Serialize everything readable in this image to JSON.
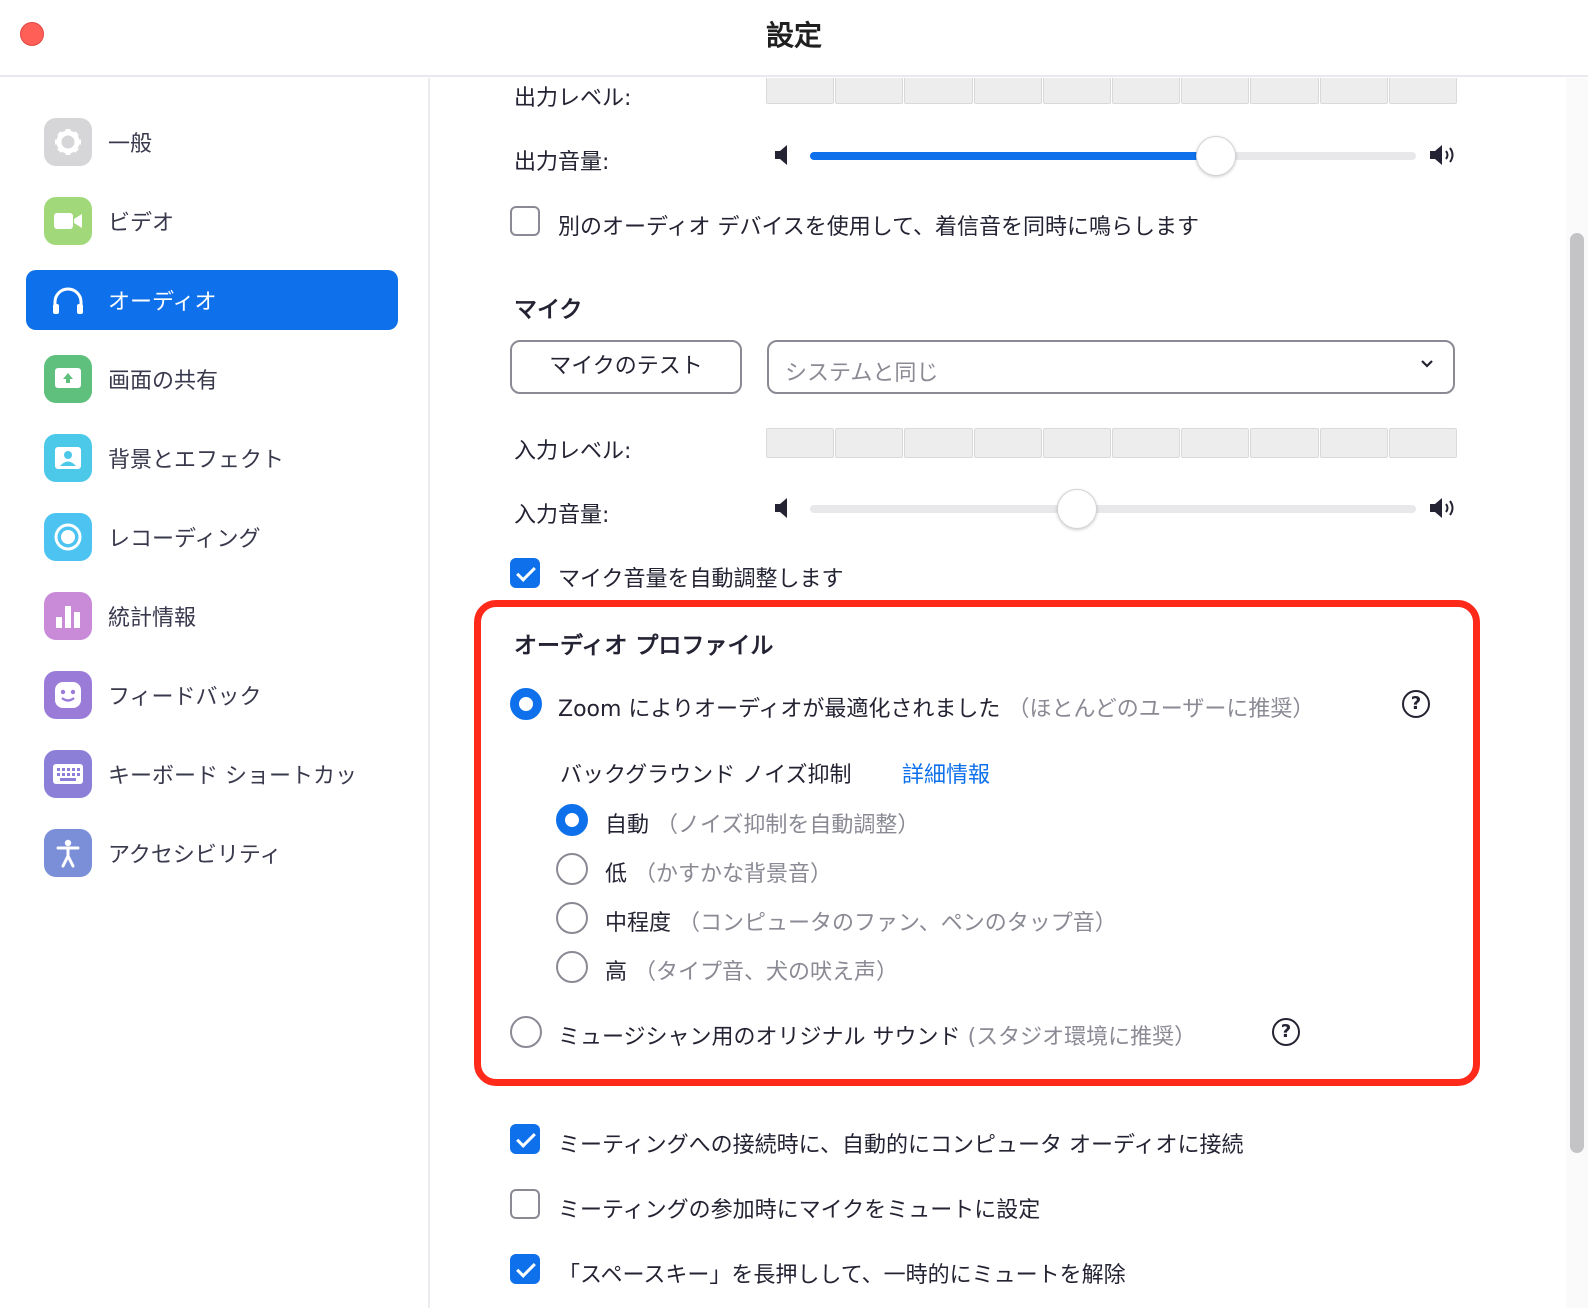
{
  "window": {
    "title": "設定"
  },
  "sidebar": {
    "items": [
      {
        "label": "一般",
        "icon": "gear-icon",
        "color": "#d6d6d8",
        "active": false
      },
      {
        "label": "ビデオ",
        "icon": "video-camera-icon",
        "color": "#a1d87a",
        "active": false
      },
      {
        "label": "オーディオ",
        "icon": "headphones-icon",
        "color": "#0e71eb",
        "active": true
      },
      {
        "label": "画面の共有",
        "icon": "share-screen-icon",
        "color": "#5fbf7d",
        "active": false
      },
      {
        "label": "背景とエフェクト",
        "icon": "background-person-icon",
        "color": "#4cc9e8",
        "active": false
      },
      {
        "label": "レコーディング",
        "icon": "record-icon",
        "color": "#4cc3f0",
        "active": false
      },
      {
        "label": "統計情報",
        "icon": "bar-chart-icon",
        "color": "#c98bd8",
        "active": false
      },
      {
        "label": "フィードバック",
        "icon": "smile-icon",
        "color": "#9b7bd8",
        "active": false
      },
      {
        "label": "キーボード ショートカッ",
        "icon": "keyboard-icon",
        "color": "#8b7fd8",
        "active": false
      },
      {
        "label": "アクセシビリティ",
        "icon": "accessibility-icon",
        "color": "#7b8fd8",
        "active": false
      }
    ]
  },
  "speaker": {
    "output_level_label": "出力レベル:",
    "output_volume_label": "出力音量:",
    "output_volume_value": 0.67,
    "separate_device_label": "別のオーディオ デバイスを使用して、着信音を同時に鳴らします",
    "separate_device_checked": false
  },
  "mic": {
    "section_title": "マイク",
    "test_button_label": "マイクのテスト",
    "device_select_value": "システムと同じ",
    "input_level_label": "入力レベル:",
    "input_volume_label": "入力音量:",
    "input_volume_value": 0.44,
    "auto_adjust_label": "マイク音量を自動調整します",
    "auto_adjust_checked": true
  },
  "audio_profile": {
    "title": "オーディオ プロファイル",
    "zoom_optimized_label": "Zoom によりオーディオが最適化されました",
    "zoom_optimized_hint": "（ほとんどのユーザーに推奨）",
    "noise_suppression_label": "バックグラウンド ノイズ抑制",
    "details_link": "詳細情報",
    "noise_options": [
      {
        "label": "自動",
        "hint": "（ノイズ抑制を自動調整）",
        "selected": true
      },
      {
        "label": "低",
        "hint": "（かすかな背景音）",
        "selected": false
      },
      {
        "label": "中程度",
        "hint": "（コンピュータのファン、ペンのタップ音）",
        "selected": false
      },
      {
        "label": "高",
        "hint": "（タイプ音、犬の吠え声）",
        "selected": false
      }
    ],
    "original_sound_label": "ミュージシャン用のオリジナル サウンド",
    "original_sound_hint": "(スタジオ環境に推奨）",
    "help_glyph": "?"
  },
  "options": [
    {
      "label": "ミーティングへの接続時に、自動的にコンピュータ オーディオに接続",
      "checked": true
    },
    {
      "label": "ミーティングの参加時にマイクをミュートに設定",
      "checked": false
    },
    {
      "label": "「スペースキー」を長押しして、一時的にミュートを解除",
      "checked": true
    }
  ],
  "colors": {
    "accent": "#0e71eb",
    "highlight": "#ff2a1a"
  }
}
